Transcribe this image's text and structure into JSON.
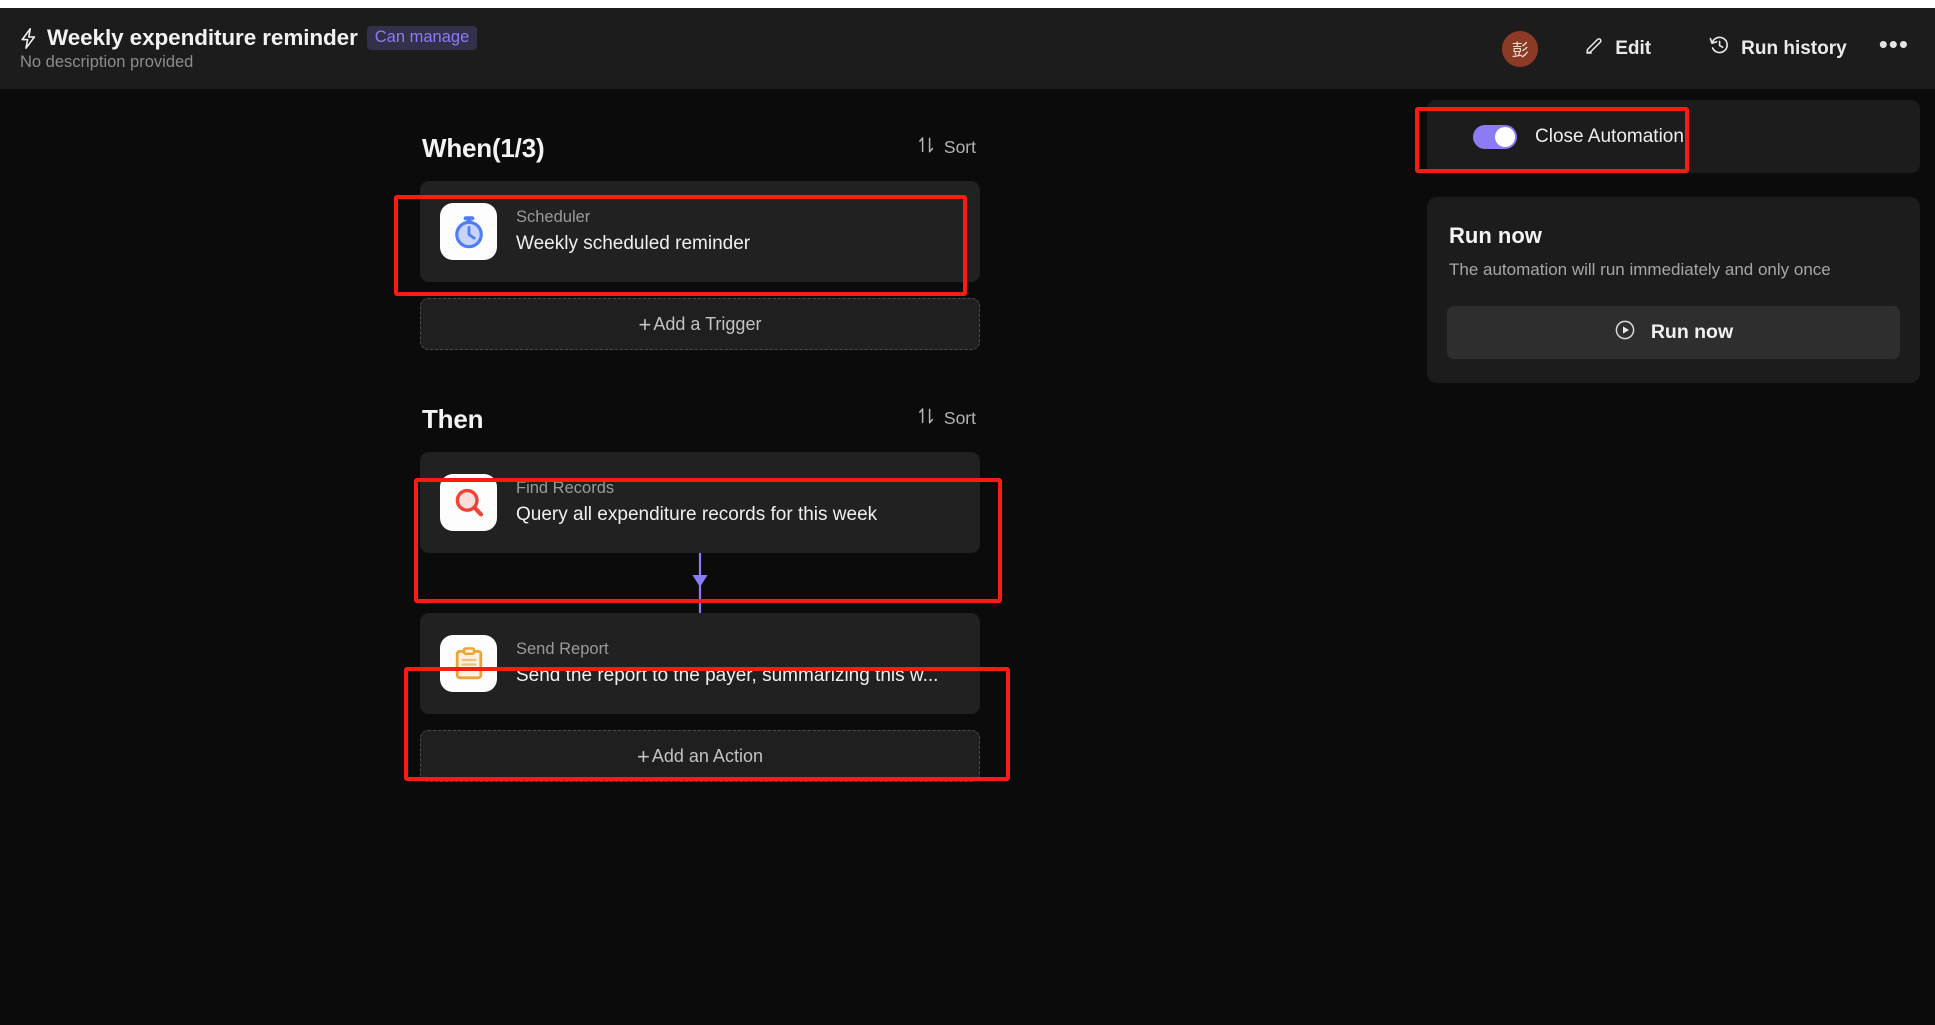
{
  "header": {
    "bolt_icon": "lightning-bolt-icon",
    "title": "Weekly expenditure reminder",
    "permission_badge": "Can manage",
    "subtitle": "No description provided",
    "avatar_initial": "彭",
    "edit_label": "Edit",
    "edit_icon": "pencil-icon",
    "run_history_label": "Run history",
    "run_history_icon": "history-clock-icon",
    "more_label": "•••",
    "more_icon": "more-horizontal-icon"
  },
  "flow": {
    "when_section": {
      "title": "When(1/3)",
      "sort_label": "Sort",
      "sort_icon": "sort-arrows-icon",
      "nodes": [
        {
          "type": "Scheduler",
          "description": "Weekly scheduled reminder",
          "icon": "stopwatch-icon",
          "icon_color": "#4f7df9"
        }
      ],
      "add_label": "Add a Trigger"
    },
    "then_section": {
      "title": "Then",
      "sort_label": "Sort",
      "sort_icon": "sort-arrows-icon",
      "nodes": [
        {
          "type": "Find Records",
          "description": "Query all expenditure records for this week",
          "icon": "magnifier-icon",
          "icon_color": "#ef4338"
        },
        {
          "type": "Send Report",
          "description": "Send the report to the payer, summarizing this w...",
          "icon": "clipboard-icon",
          "icon_color": "#eda434"
        }
      ],
      "add_label": "Add an Action",
      "connector_color": "#8b7cf6"
    }
  },
  "right_panel": {
    "toggle": {
      "label": "Close Automation",
      "state": "on",
      "accent_color": "#8b7cf6"
    },
    "run_now": {
      "title": "Run now",
      "subtitle": "The automation will run immediately and only once",
      "button_label": "Run now",
      "button_icon": "play-circle-icon"
    }
  },
  "annotations": {
    "highlight_color": "#fc1b12",
    "boxes": [
      "scheduler-node-highlight",
      "find-records-node-highlight",
      "send-report-node-highlight",
      "close-automation-toggle-highlight"
    ]
  }
}
